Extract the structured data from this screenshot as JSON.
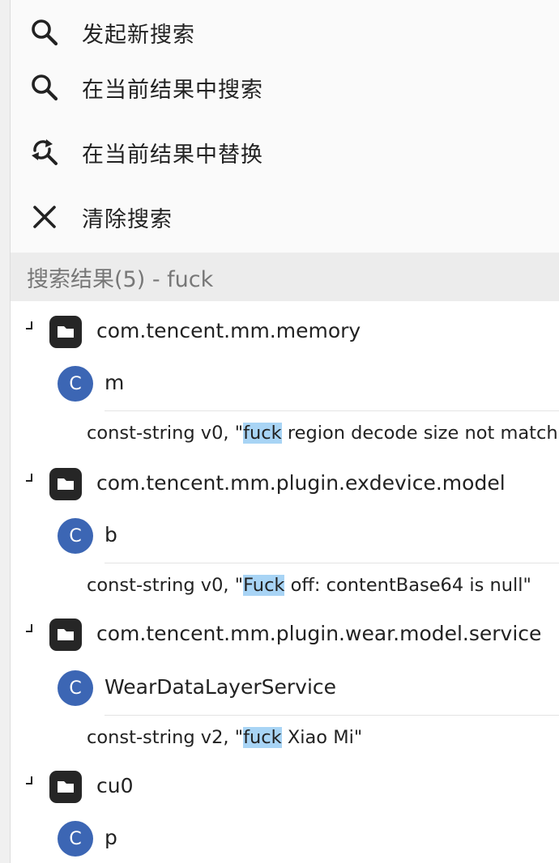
{
  "menu": {
    "items": [
      {
        "icon": "search-icon",
        "label": "发起新搜索"
      },
      {
        "icon": "search-icon",
        "label": "在当前结果中搜索"
      },
      {
        "icon": "replace-icon",
        "label": "在当前结果中替换"
      },
      {
        "icon": "close-icon",
        "label": "清除搜索"
      }
    ]
  },
  "results": {
    "header": "搜索结果(5) - fuck",
    "groups": [
      {
        "package": "com.tencent.mm.memory",
        "class": "m",
        "match": {
          "prefix": "const-string v0, \"",
          "highlight": "fuck",
          "suffix": " region decode size not match,"
        }
      },
      {
        "package": "com.tencent.mm.plugin.exdevice.model",
        "class": "b",
        "match": {
          "prefix": "const-string v0, \"",
          "highlight": "Fuck",
          "suffix": " off: contentBase64 is null\""
        }
      },
      {
        "package": "com.tencent.mm.plugin.wear.model.service",
        "class": "WearDataLayerService",
        "match": {
          "prefix": "const-string v2, \"",
          "highlight": "fuck",
          "suffix": " Xiao Mi\""
        }
      },
      {
        "package": "cu0",
        "class": "p"
      }
    ],
    "class_badge_letter": "C"
  },
  "colors": {
    "highlight": "#a8d4f5",
    "class_badge": "#3c66b4",
    "header_bg": "#ececec"
  }
}
